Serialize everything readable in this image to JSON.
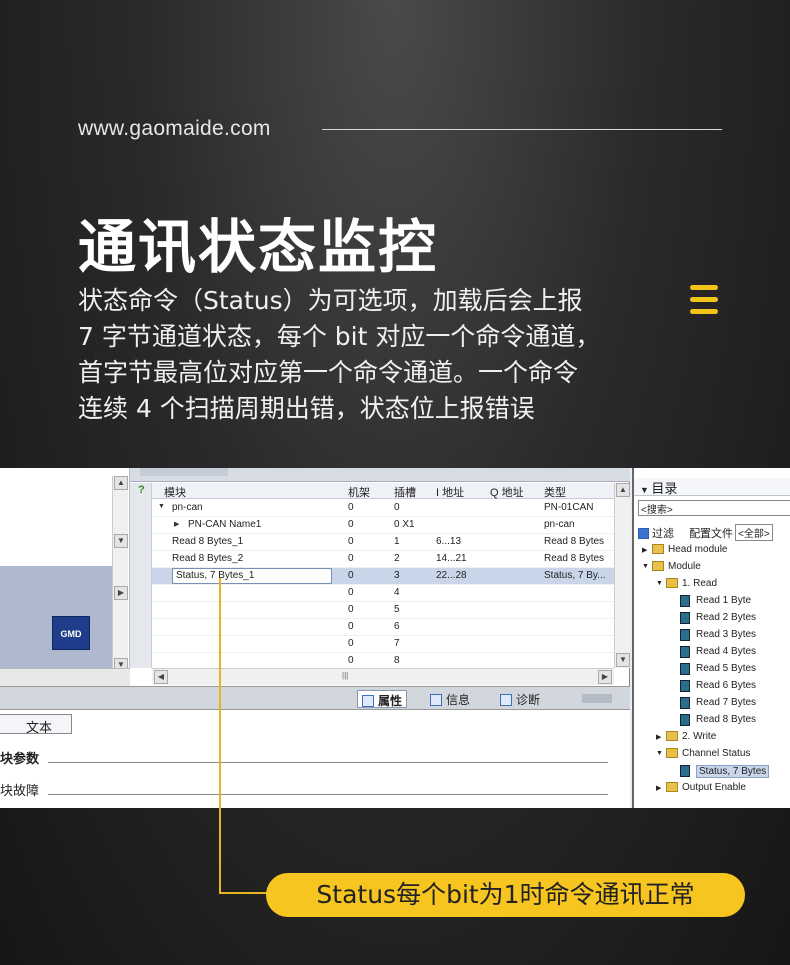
{
  "header": {
    "site_url": "www.gaomaide.com",
    "title": "通讯状态监控",
    "description_lines": [
      "状态命令（Status）为可选项，加载后会上报",
      "7 字节通道状态，每个 bit 对应一个命令通道，",
      "首字节最高位对应第一个命令通道。一个命令",
      "连续 4 个扫描周期出错，状态位上报错误"
    ],
    "accent_color": "#f2c419",
    "menu_icon": "hamburger-menu-icon"
  },
  "left_pane": {
    "logo_text": "GMD"
  },
  "device_table": {
    "columns": [
      "模块",
      "机架",
      "插槽",
      "I 地址",
      "Q 地址",
      "类型"
    ],
    "rows": [
      {
        "module": "pn-can",
        "rack": "0",
        "slot": "0",
        "i_addr": "",
        "q_addr": "",
        "type": "PN-01CAN",
        "indent": 1,
        "expand": "▼"
      },
      {
        "module": "PN-CAN Name1",
        "rack": "0",
        "slot": "0 X1",
        "i_addr": "",
        "q_addr": "",
        "type": "pn-can",
        "indent": 2,
        "expand": "▶"
      },
      {
        "module": "Read 8 Bytes_1",
        "rack": "0",
        "slot": "1",
        "i_addr": "6...13",
        "q_addr": "",
        "type": "Read 8 Bytes",
        "indent": 0,
        "expand": ""
      },
      {
        "module": "Read 8 Bytes_2",
        "rack": "0",
        "slot": "2",
        "i_addr": "14...21",
        "q_addr": "",
        "type": "Read 8 Bytes",
        "indent": 0,
        "expand": ""
      },
      {
        "module": "Status, 7 Bytes_1",
        "rack": "0",
        "slot": "3",
        "i_addr": "22...28",
        "q_addr": "",
        "type": "Status, 7 By...",
        "indent": 0,
        "expand": "",
        "selected": true
      },
      {
        "module": "",
        "rack": "0",
        "slot": "4",
        "i_addr": "",
        "q_addr": "",
        "type": "",
        "indent": 0,
        "expand": ""
      },
      {
        "module": "",
        "rack": "0",
        "slot": "5",
        "i_addr": "",
        "q_addr": "",
        "type": "",
        "indent": 0,
        "expand": ""
      },
      {
        "module": "",
        "rack": "0",
        "slot": "6",
        "i_addr": "",
        "q_addr": "",
        "type": "",
        "indent": 0,
        "expand": ""
      },
      {
        "module": "",
        "rack": "0",
        "slot": "7",
        "i_addr": "",
        "q_addr": "",
        "type": "",
        "indent": 0,
        "expand": ""
      },
      {
        "module": "",
        "rack": "0",
        "slot": "8",
        "i_addr": "",
        "q_addr": "",
        "type": "",
        "indent": 0,
        "expand": ""
      }
    ]
  },
  "inspector": {
    "tabs": [
      {
        "label": "属性",
        "active": true
      },
      {
        "label": "信息",
        "active": false
      },
      {
        "label": "诊断",
        "active": false
      }
    ],
    "text_tab": "文本",
    "section1": "块参数",
    "section2": "块故障"
  },
  "catalog": {
    "title": "目录",
    "search_placeholder": "<搜索>",
    "filter_label": "过滤",
    "profile_label": "配置文件",
    "profile_value": "<全部>",
    "tree": [
      {
        "label": "Head module",
        "level": 0,
        "kind": "folder",
        "expand": "▶"
      },
      {
        "label": "Module",
        "level": 0,
        "kind": "folder",
        "expand": "▼"
      },
      {
        "label": "1. Read",
        "level": 1,
        "kind": "folder",
        "expand": "▼"
      },
      {
        "label": "Read 1 Byte",
        "level": 2,
        "kind": "module",
        "expand": ""
      },
      {
        "label": "Read 2 Bytes",
        "level": 2,
        "kind": "module",
        "expand": ""
      },
      {
        "label": "Read 3 Bytes",
        "level": 2,
        "kind": "module",
        "expand": ""
      },
      {
        "label": "Read 4 Bytes",
        "level": 2,
        "kind": "module",
        "expand": ""
      },
      {
        "label": "Read 5 Bytes",
        "level": 2,
        "kind": "module",
        "expand": ""
      },
      {
        "label": "Read 6 Bytes",
        "level": 2,
        "kind": "module",
        "expand": ""
      },
      {
        "label": "Read 7 Bytes",
        "level": 2,
        "kind": "module",
        "expand": ""
      },
      {
        "label": "Read 8 Bytes",
        "level": 2,
        "kind": "module",
        "expand": ""
      },
      {
        "label": "2. Write",
        "level": 1,
        "kind": "folder",
        "expand": "▶"
      },
      {
        "label": "Channel Status",
        "level": 1,
        "kind": "folder",
        "expand": "▼"
      },
      {
        "label": "Status, 7 Bytes",
        "level": 2,
        "kind": "module",
        "expand": "",
        "selected": true
      },
      {
        "label": "Output Enable",
        "level": 1,
        "kind": "folder",
        "expand": "▶"
      }
    ]
  },
  "callout": {
    "text": "Status每个bit为1时命令通讯正常",
    "color": "#f7c51f"
  }
}
